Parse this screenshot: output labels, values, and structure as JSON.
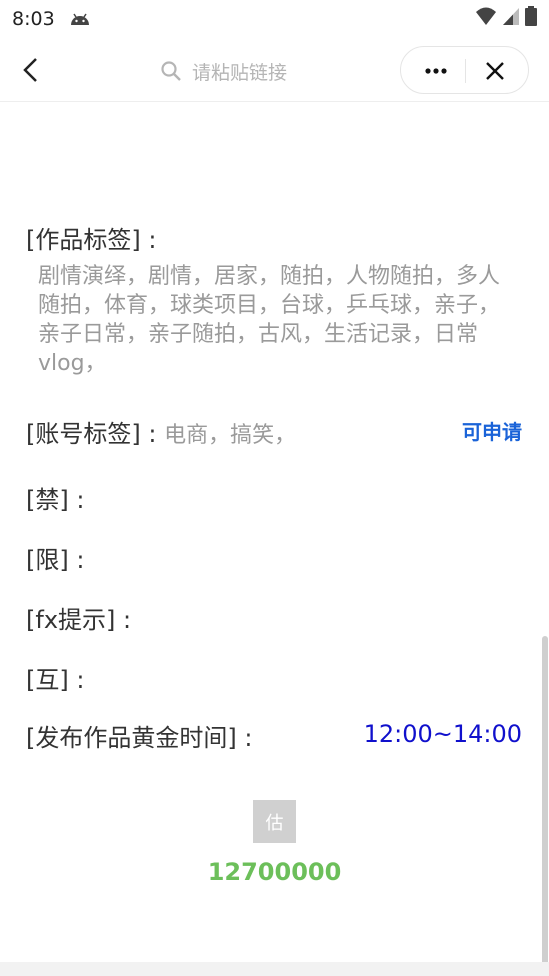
{
  "status": {
    "time": "8:03"
  },
  "search": {
    "placeholder": "请粘贴链接"
  },
  "fields": {
    "work_tags_label": "[作品标签] :",
    "work_tags": "剧情演绎，剧情，居家，随拍，人物随拍，多人随拍，体育，球类项目，台球，乒乓球，亲子，亲子日常，亲子随拍，古风，生活记录，日常vlog，",
    "account_tags_label": "[账号标签] :",
    "account_tags": "电商，搞笑，",
    "apply_link": "可申请",
    "ban_label": "[禁] :",
    "limit_label": "[限] :",
    "fx_label": "[fx提示] :",
    "mutual_label": "[互] :",
    "gold_time_label": "[发布作品黄金时间] :",
    "gold_time": "12:00~14:00"
  },
  "estimate": {
    "button": "估",
    "value": "12700000"
  },
  "colors": {
    "link": "#1a63d8",
    "time": "#1010cc",
    "estimate": "#6cbf5a"
  }
}
